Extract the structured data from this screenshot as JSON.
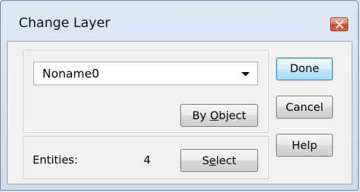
{
  "dialog": {
    "title": "Change Layer",
    "close_icon": "close-icon"
  },
  "layer_select": {
    "value": "Noname0",
    "arrow_icon": "dropdown-arrow-icon"
  },
  "by_object_button": {
    "label_pre": "By ",
    "label_mnemonic": "O",
    "label_post": "bject"
  },
  "entities": {
    "label": "Entities:",
    "count": "4"
  },
  "select_button": {
    "label_pre": "S",
    "label_mnemonic": "e",
    "label_post": "lect"
  },
  "side_buttons": {
    "done": "Done",
    "cancel": "Cancel",
    "help": "Help"
  },
  "colors": {
    "title_bar": "#dde8f5",
    "client_bg": "#f0f0f0",
    "close_button": "#c7452b",
    "default_button_border": "#3c7fb1"
  }
}
